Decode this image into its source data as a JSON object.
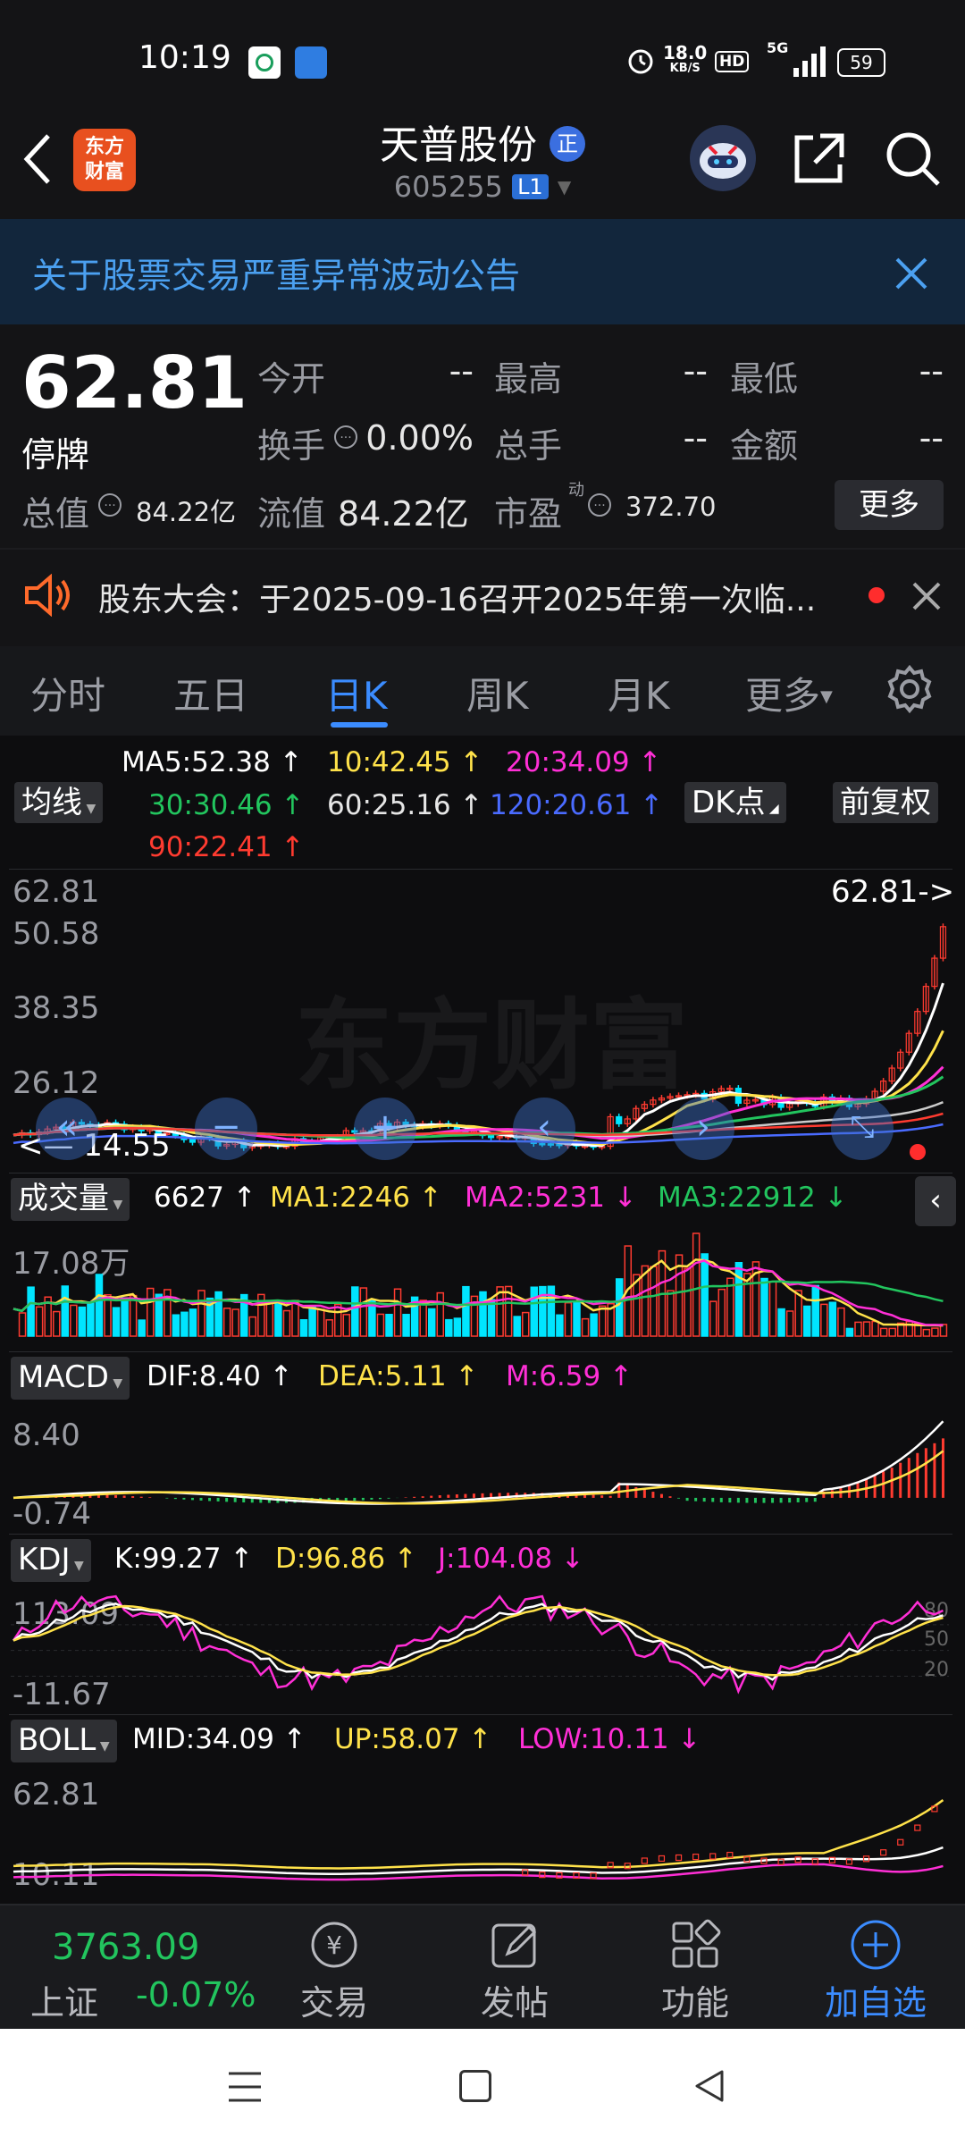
{
  "status_bar": {
    "time": "10:19",
    "net_speed_value": "18.0",
    "net_speed_unit": "KB/S",
    "hd": "HD",
    "signal": "5G",
    "battery": "59"
  },
  "header": {
    "logo_line1": "东方",
    "logo_line2": "财富",
    "stock_name": "天普股份",
    "badge": "正",
    "stock_code": "605255",
    "level": "L1"
  },
  "notice": {
    "text": "关于股票交易严重异常波动公告"
  },
  "quote": {
    "price": "62.81",
    "status": "停牌",
    "open_label": "今开",
    "open_value": "--",
    "high_label": "最高",
    "high_value": "--",
    "low_label": "最低",
    "low_value": "--",
    "turnover_label": "换手",
    "turnover_value": "0.00%",
    "volume_label": "总手",
    "volume_value": "--",
    "amount_label": "金额",
    "amount_value": "--",
    "market_cap_label": "总值",
    "market_cap_value": "84.22亿",
    "float_cap_label": "流值",
    "float_cap_value": "84.22亿",
    "pe_label": "市盈",
    "pe_super": "动",
    "pe_value": "372.70",
    "more_button": "更多"
  },
  "announcement": {
    "text": "股东大会：于2025-09-16召开2025年第一次临..."
  },
  "tabs": [
    "分时",
    "五日",
    "日K",
    "周K",
    "月K",
    "更多"
  ],
  "active_tab": "日K",
  "kline": {
    "ma_button": "均线",
    "ma5": "MA5:52.38",
    "ma10": "10:42.45",
    "ma20": "20:34.09",
    "ma30": "30:30.46",
    "ma60": "60:25.16",
    "ma120": "120:20.61",
    "ma90": "90:22.41",
    "dk_button": "DK点",
    "adjust_button": "前复权",
    "watermark": "东方财富",
    "axis": [
      "62.81",
      "50.58",
      "38.35",
      "26.12",
      "14.55"
    ],
    "last_price_tag": "62.81->",
    "low_marker": "14.55"
  },
  "volume_panel": {
    "label": "成交量",
    "value": "6627",
    "ma1": "MA1:2246",
    "ma2": "MA2:5231",
    "ma3": "MA3:22912",
    "axis_top": "17.08万"
  },
  "macd_panel": {
    "label": "MACD",
    "dif": "DIF:8.40",
    "dea": "DEA:5.11",
    "m": "M:6.59",
    "axis_top": "8.40",
    "axis_bottom": "-0.74"
  },
  "kdj_panel": {
    "label": "KDJ",
    "k": "K:99.27",
    "d": "D:96.86",
    "j": "J:104.08",
    "axis_top": "113.09",
    "axis_bottom": "-11.67",
    "levels": [
      "80",
      "50",
      "20"
    ]
  },
  "boll_panel": {
    "label": "BOLL",
    "mid": "MID:34.09",
    "up": "UP:58.07",
    "low": "LOW:10.11",
    "axis_top": "62.81",
    "axis_bottom": "10.11"
  },
  "bottom_bar": {
    "index_value": "3763.09",
    "index_name": "上证",
    "index_change": "-0.07%",
    "trade": "交易",
    "post": "发帖",
    "functions": "功能",
    "add_watch": "加自选"
  },
  "colors": {
    "up": "#ff3b30",
    "down": "#00e5ff",
    "green": "#22c55e",
    "yellow": "#ffe24a",
    "magenta": "#ff2fd6",
    "accent": "#3b8cff"
  }
}
